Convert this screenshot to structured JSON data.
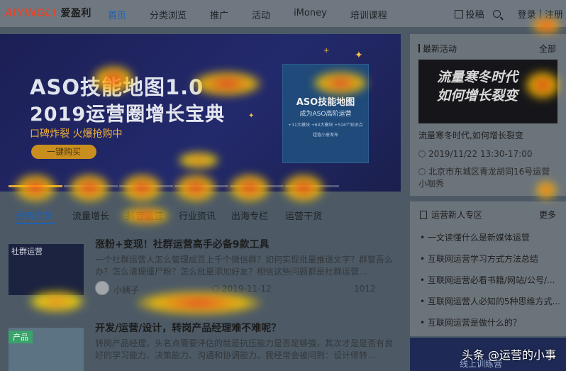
{
  "header": {
    "logo_en": "AIYINGLI",
    "logo_cn": "爱盈利",
    "nav": [
      "首页",
      "分类浏览",
      "推广",
      "活动",
      "iMoney",
      "培训课程"
    ],
    "post_label": "投稿",
    "login_label": "登录",
    "separator": "|",
    "register_label": "注册"
  },
  "banner": {
    "title": "ASO技能地图1.0",
    "subtitle": "2019运营圈增长宝典",
    "tagline": "口碑炸裂 火爆抢购中",
    "button": "一键购买",
    "book_title": "ASO技能地图",
    "book_subtitle": "成为ASO高阶运营",
    "book_line1": "+11大模块 +60大模块 +516个知识点",
    "book_line2": "超值小册发布"
  },
  "activity": {
    "title": "最新活动",
    "all_label": "全部",
    "image_line1": "流量寒冬时代",
    "image_line2": "如何增长裂变",
    "caption": "流量寒冬时代,如何增长裂变",
    "time": "2019/11/22 13:30-17:00",
    "address": "北京市东城区青龙胡同16号运营小咖秀"
  },
  "tabs": [
    "最新文章",
    "流量增长",
    "抖音运营",
    "行业资讯",
    "出海专栏",
    "运营干货"
  ],
  "articles": [
    {
      "thumb_label": "社群运营",
      "title": "涨粉+变现！社群运营高手必备9款工具",
      "desc": "一个社群运营人怎么管理成百上千个微信群？如何实现批量推送文字？群管吾么办？怎么清理僵尸粉？怎么批量添加好友？相信这些问题都是社群运营...",
      "author": "小姨子",
      "date": "2019-11-12",
      "views": "1012"
    },
    {
      "thumb_label": "产品",
      "title": "开发/运营/设计，转岗产品经理难不难呢？",
      "desc": "转岗产品经理，头名点需要评估的就是抗压能力是否足够强，其次才是是否有良好的学习能力、决策能力、沟通和协调能力。我经常会被问到：设计师转..."
    }
  ],
  "newbie": {
    "title": "运营新人专区",
    "more_label": "更多",
    "items": [
      "• 一文读懂什么是新媒体运营",
      "• 互联网运营学习方式方法总结",
      "• 互联网运营必看书籍/网站/公号/...",
      "• 互联网运营人必知的5种思维方式...",
      "• 互联网运营是做什么的？"
    ]
  },
  "training_label": "线上训练营",
  "watermark": "头条 @运营的小事"
}
